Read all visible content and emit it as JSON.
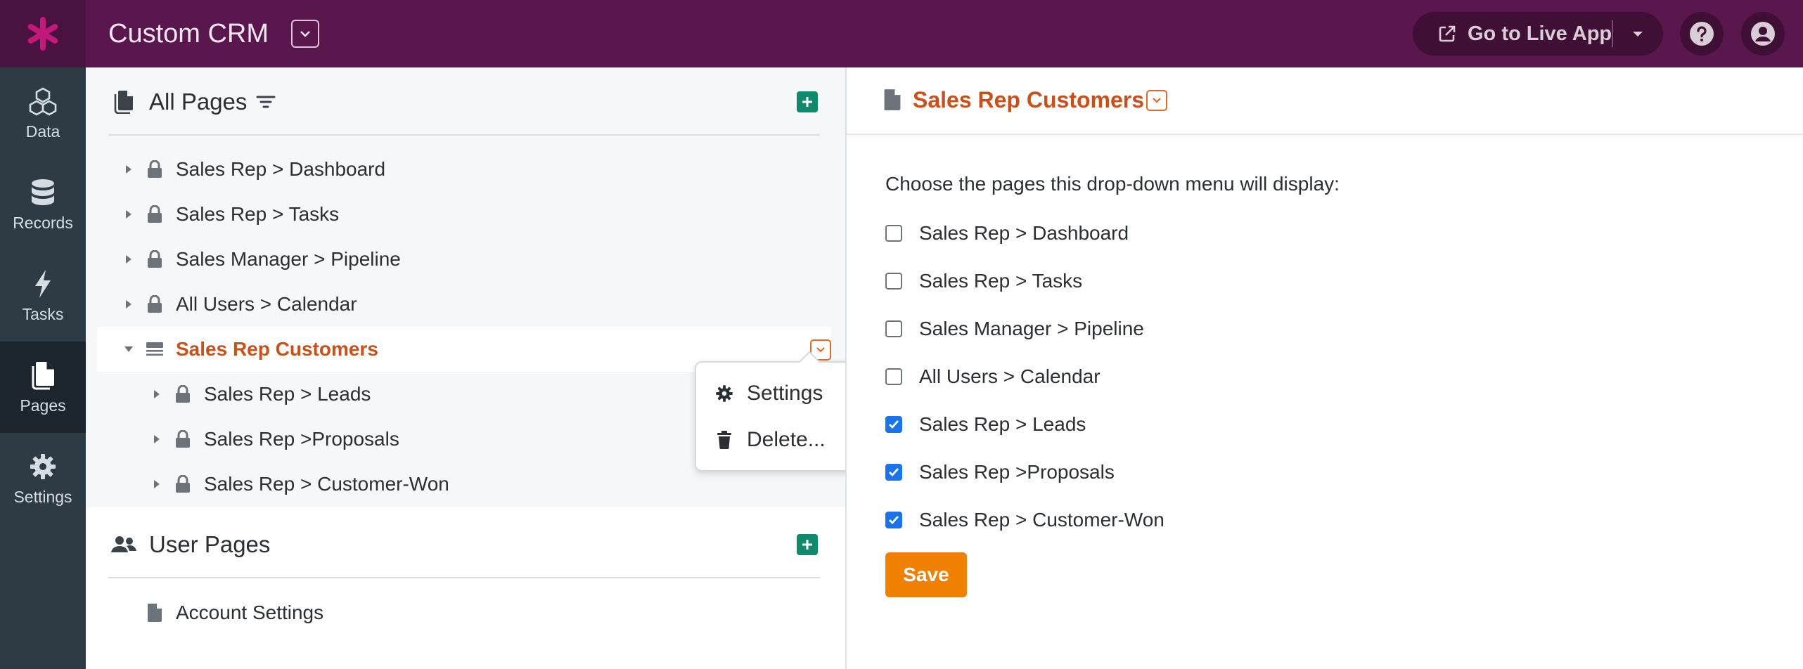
{
  "app": {
    "title": "Custom CRM",
    "logo_icon": "asterisk-logo-icon"
  },
  "topbar": {
    "live_app_label": "Go to Live App"
  },
  "sidebar": {
    "items": [
      {
        "label": "Data",
        "icon": "cubes-icon"
      },
      {
        "label": "Records",
        "icon": "database-icon"
      },
      {
        "label": "Tasks",
        "icon": "bolt-icon"
      },
      {
        "label": "Pages",
        "icon": "pages-icon"
      },
      {
        "label": "Settings",
        "icon": "gear-icon"
      }
    ],
    "active": "Pages"
  },
  "all_pages": {
    "title": "All Pages",
    "items": [
      {
        "label": "Sales Rep > Dashboard"
      },
      {
        "label": "Sales Rep > Tasks"
      },
      {
        "label": "Sales Manager > Pipeline"
      },
      {
        "label": "All Users > Calendar"
      },
      {
        "label": "Sales Rep Customers"
      },
      {
        "label": "Sales Rep > Leads"
      },
      {
        "label": "Sales Rep >Proposals"
      },
      {
        "label": "Sales Rep > Customer-Won"
      }
    ]
  },
  "user_pages": {
    "title": "User Pages",
    "items": [
      {
        "label": "Account Settings"
      }
    ]
  },
  "context_menu": {
    "items": [
      {
        "label": "Settings",
        "icon": "gear-icon"
      },
      {
        "label": "Delete...",
        "icon": "trash-icon"
      }
    ]
  },
  "detail": {
    "title": "Sales Rep Customers",
    "instruction": "Choose the pages this drop-down menu will display:",
    "options": [
      {
        "label": "Sales Rep > Dashboard",
        "checked": false
      },
      {
        "label": "Sales Rep > Tasks",
        "checked": false
      },
      {
        "label": "Sales Manager > Pipeline",
        "checked": false
      },
      {
        "label": "All Users > Calendar",
        "checked": false
      },
      {
        "label": "Sales Rep > Leads",
        "checked": true
      },
      {
        "label": "Sales Rep >Proposals",
        "checked": true
      },
      {
        "label": "Sales Rep > Customer-Won",
        "checked": true
      }
    ],
    "save_label": "Save"
  },
  "colors": {
    "topbar": "#5a174d",
    "sidebar": "#2f3b44",
    "accent_orange": "#c8501a",
    "save_orange": "#f08000",
    "add_green": "#11896d",
    "checkbox_blue": "#1a73e8"
  }
}
